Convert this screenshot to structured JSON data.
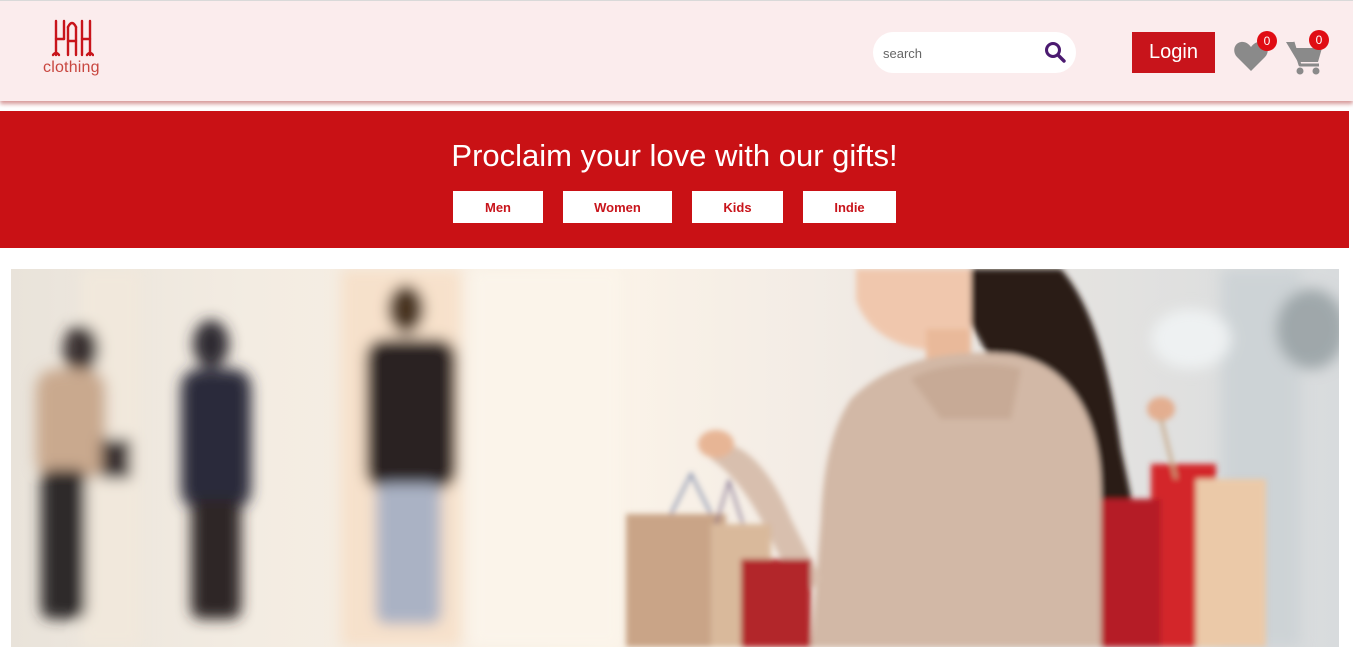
{
  "header": {
    "logo_text": "clothing",
    "search": {
      "placeholder": "search"
    },
    "login_label": "Login",
    "wishlist_count": "0",
    "cart_count": "0"
  },
  "banner": {
    "title": "Proclaim your love with our gifts!",
    "categories": [
      {
        "label": "Men"
      },
      {
        "label": "Women"
      },
      {
        "label": "Kids"
      },
      {
        "label": "Indie"
      }
    ]
  },
  "colors": {
    "brand_red": "#c91115",
    "header_bg": "#fbeced",
    "search_icon": "#4b1a70",
    "icon_gray": "#8a8a8a",
    "badge_red": "#e00d14"
  },
  "icons": [
    "logo-icon",
    "search-icon",
    "heart-icon",
    "cart-icon"
  ]
}
